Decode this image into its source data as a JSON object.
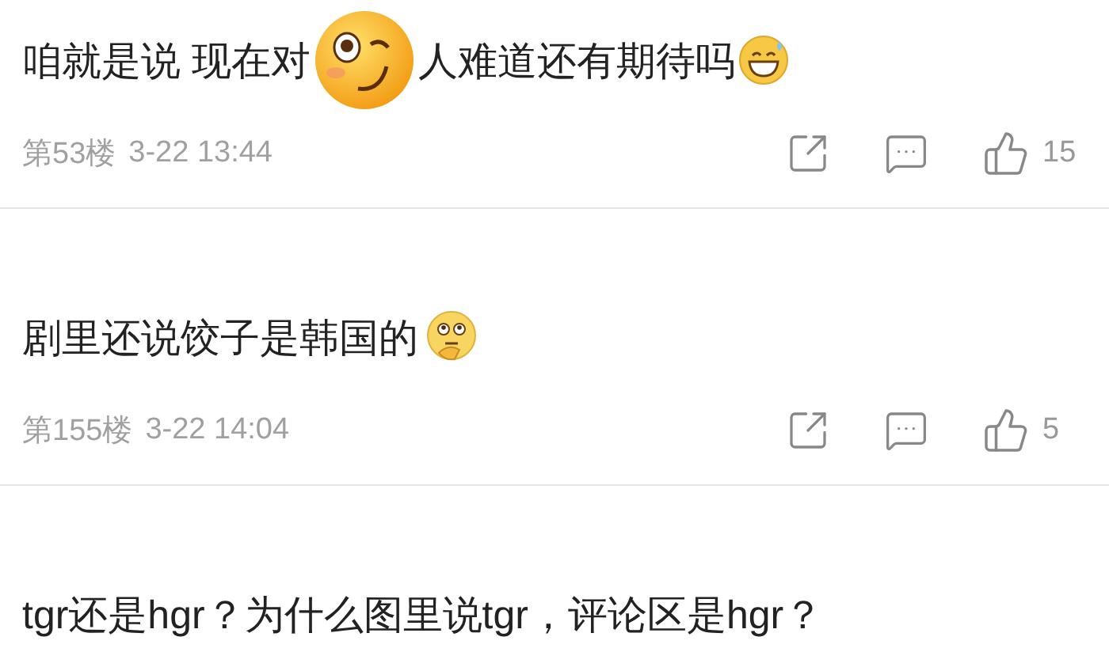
{
  "comments": [
    {
      "text_parts": [
        "咱就是说 现在对",
        "人难道还有期待吗"
      ],
      "emoji": {
        "kind": "grin-sweat"
      },
      "sticker": {
        "kind": "wink"
      },
      "floor": "第53楼",
      "date": "3-22 13:44",
      "likes": "15"
    },
    {
      "text_parts": [
        "剧里还说饺子是韩国的"
      ],
      "emoji": {
        "kind": "thinking"
      },
      "floor": "第155楼",
      "date": "3-22 14:04",
      "likes": "5"
    },
    {
      "text_parts": [
        "tgr还是hgr？为什么图里说tgr，评论区是hgr？"
      ]
    }
  ]
}
